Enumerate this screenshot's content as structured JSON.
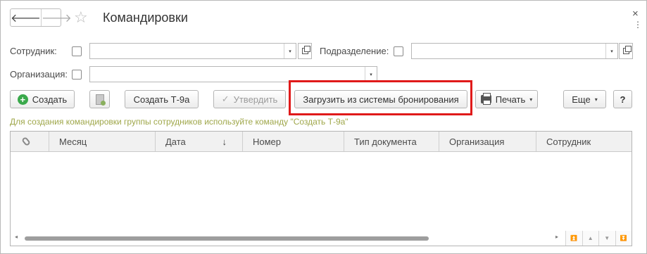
{
  "window": {
    "title": "Командировки",
    "close_glyph": "×",
    "more_glyph": "⋮",
    "back_glyph": "🡐",
    "forward_glyph": "🡒",
    "star_glyph": "☆"
  },
  "filters": {
    "employee_label": "Сотрудник:",
    "department_label": "Подразделение:",
    "organization_label": "Организация:",
    "employee_value": "",
    "department_value": "",
    "organization_value": ""
  },
  "toolbar": {
    "create_label": "Создать",
    "create_t9a_label": "Создать Т-9а",
    "approve_label": "Утвердить",
    "load_booking_label": "Загрузить из системы бронирования",
    "print_label": "Печать",
    "more_label": "Еще",
    "help_label": "?",
    "dropdown_glyph": "▾",
    "check_glyph": "✓"
  },
  "hint": "Для создания командировки группы сотрудников используйте команду \"Создать Т-9а\"",
  "table": {
    "columns": [
      "Месяц",
      "Дата",
      "Номер",
      "Тип документа",
      "Организация",
      "Сотрудник"
    ],
    "sort_glyph": "↓",
    "rows": []
  },
  "scroll": {
    "left_glyph": "◂",
    "right_glyph": "▸",
    "nav": [
      "⏫",
      "▲",
      "▼",
      "⏬"
    ]
  },
  "colors": {
    "highlight": "#e01a1a",
    "hint": "#9fa74a",
    "create_icon": "#3aa94b"
  }
}
